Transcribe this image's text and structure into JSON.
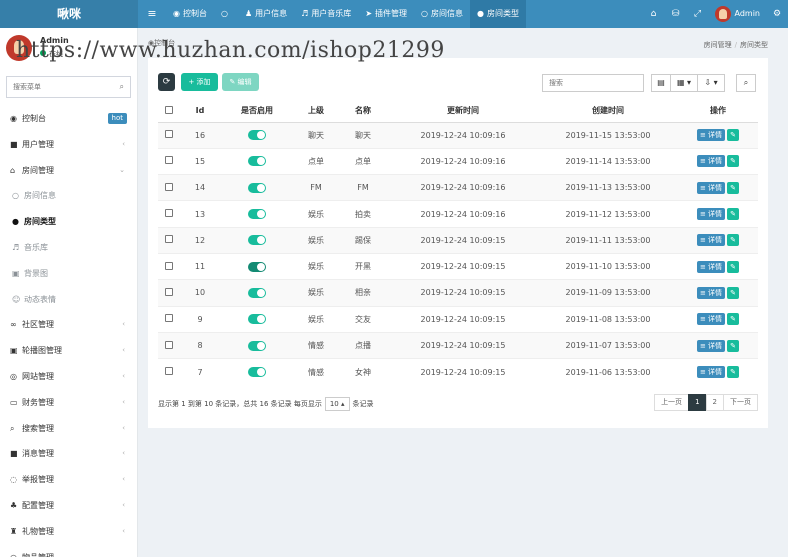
{
  "app": {
    "brand": "啾咪"
  },
  "topnav": [
    {
      "icon": "dashboard-icon",
      "glyph": "◉",
      "label": "控制台"
    },
    {
      "icon": "circle-icon",
      "glyph": "○",
      "label": ""
    },
    {
      "icon": "user-icon",
      "glyph": "♟",
      "label": "用户信息"
    },
    {
      "icon": "music-icon",
      "glyph": "♬",
      "label": "用户音乐库"
    },
    {
      "icon": "plugin-icon",
      "glyph": "➤",
      "label": "插件管理"
    },
    {
      "icon": "room-info-icon",
      "glyph": "○",
      "label": "房间信息"
    },
    {
      "icon": "room-type-icon",
      "glyph": "●",
      "label": "房间类型"
    }
  ],
  "topright": {
    "username": "Admin"
  },
  "sidebar": {
    "user_name": "Admin",
    "status": "在线",
    "search_placeholder": "搜索菜单",
    "items": [
      {
        "label": "控制台",
        "glyph": "◉",
        "icon": "dashboard-icon",
        "badge": "hot",
        "type": "main"
      },
      {
        "label": "用户管理",
        "glyph": "■",
        "icon": "user-manage-icon",
        "arrow": "‹",
        "type": "main"
      },
      {
        "label": "房间管理",
        "glyph": "⌂",
        "icon": "bank-icon",
        "arrow": "⌄",
        "type": "main"
      },
      {
        "label": "房间信息",
        "glyph": "○",
        "icon": "circle-icon",
        "type": "sub"
      },
      {
        "label": "房间类型",
        "glyph": "●",
        "icon": "dot-icon",
        "type": "sub-active"
      },
      {
        "label": "音乐库",
        "glyph": "♬",
        "icon": "music-icon",
        "type": "sub"
      },
      {
        "label": "背景图",
        "glyph": "▣",
        "icon": "image-icon",
        "type": "sub"
      },
      {
        "label": "动态表情",
        "glyph": "☺",
        "icon": "emoji-icon",
        "type": "sub"
      },
      {
        "label": "社区管理",
        "glyph": "∞",
        "icon": "community-icon",
        "arrow": "‹",
        "type": "main"
      },
      {
        "label": "轮播图管理",
        "glyph": "▣",
        "icon": "carousel-icon",
        "arrow": "‹",
        "type": "main"
      },
      {
        "label": "网站管理",
        "glyph": "◎",
        "icon": "website-icon",
        "arrow": "‹",
        "type": "main"
      },
      {
        "label": "财务管理",
        "glyph": "▭",
        "icon": "finance-icon",
        "arrow": "‹",
        "type": "main"
      },
      {
        "label": "搜索管理",
        "glyph": "⌕",
        "icon": "search-icon",
        "arrow": "‹",
        "type": "main"
      },
      {
        "label": "消息管理",
        "glyph": "■",
        "icon": "message-icon",
        "arrow": "‹",
        "type": "main"
      },
      {
        "label": "举报管理",
        "glyph": "◌",
        "icon": "report-icon",
        "arrow": "‹",
        "type": "main"
      },
      {
        "label": "配置管理",
        "glyph": "♣",
        "icon": "config-icon",
        "arrow": "‹",
        "type": "main"
      },
      {
        "label": "礼物管理",
        "glyph": "♜",
        "icon": "gift-icon",
        "arrow": "‹",
        "type": "main"
      },
      {
        "label": "物品管理",
        "glyph": "○",
        "icon": "item-icon",
        "type": "main"
      }
    ]
  },
  "breadcrumb": {
    "left": "控制台",
    "right": [
      "房间管理",
      "房间类型"
    ]
  },
  "watermark": "https://www.huzhan.com/ishop21299",
  "toolbar": {
    "refresh": "⟳",
    "add": "+ 添加",
    "edit": "✎ 编辑",
    "search_placeholder": "搜索",
    "view_icon": "▤",
    "columns_icon": "▦ ▾",
    "export_icon": "⇩ ▾",
    "find_icon": "⌕"
  },
  "table": {
    "headers": [
      "",
      "Id",
      "是否启用",
      "上级",
      "名称",
      "更新时间",
      "创建时间",
      "操作"
    ],
    "detail_label": "≡ 详情",
    "edit_glyph": "✎",
    "rows": [
      {
        "id": "16",
        "enabled": true,
        "parent": "聊天",
        "name": "聊天",
        "updated": "2019-12-24 10:09:16",
        "created": "2019-11-15 13:53:00"
      },
      {
        "id": "15",
        "enabled": true,
        "parent": "点单",
        "name": "点单",
        "updated": "2019-12-24 10:09:16",
        "created": "2019-11-14 13:53:00"
      },
      {
        "id": "14",
        "enabled": true,
        "parent": "FM",
        "name": "FM",
        "updated": "2019-12-24 10:09:16",
        "created": "2019-11-13 13:53:00"
      },
      {
        "id": "13",
        "enabled": true,
        "parent": "娱乐",
        "name": "拍卖",
        "updated": "2019-12-24 10:09:16",
        "created": "2019-11-12 13:53:00"
      },
      {
        "id": "12",
        "enabled": true,
        "parent": "娱乐",
        "name": "踢保",
        "updated": "2019-12-24 10:09:15",
        "created": "2019-11-11 13:53:00"
      },
      {
        "id": "11",
        "enabled": true,
        "parent": "娱乐",
        "name": "开黑",
        "updated": "2019-12-24 10:09:15",
        "created": "2019-11-10 13:53:00"
      },
      {
        "id": "10",
        "enabled": true,
        "parent": "娱乐",
        "name": "相亲",
        "updated": "2019-12-24 10:09:15",
        "created": "2019-11-09 13:53:00"
      },
      {
        "id": "9",
        "enabled": true,
        "parent": "娱乐",
        "name": "交友",
        "updated": "2019-12-24 10:09:15",
        "created": "2019-11-08 13:53:00"
      },
      {
        "id": "8",
        "enabled": true,
        "parent": "情感",
        "name": "点播",
        "updated": "2019-12-24 10:09:15",
        "created": "2019-11-07 13:53:00"
      },
      {
        "id": "7",
        "enabled": true,
        "parent": "情感",
        "name": "女神",
        "updated": "2019-12-24 10:09:15",
        "created": "2019-11-06 13:53:00"
      }
    ]
  },
  "footer": {
    "summary_prefix": "显示第 1 到第 10 条记录，总共 16 条记录 每页显示",
    "page_size": "10 ▴",
    "summary_suffix": "条记录",
    "pager": [
      "上一页",
      "1",
      "2",
      "下一页"
    ]
  }
}
